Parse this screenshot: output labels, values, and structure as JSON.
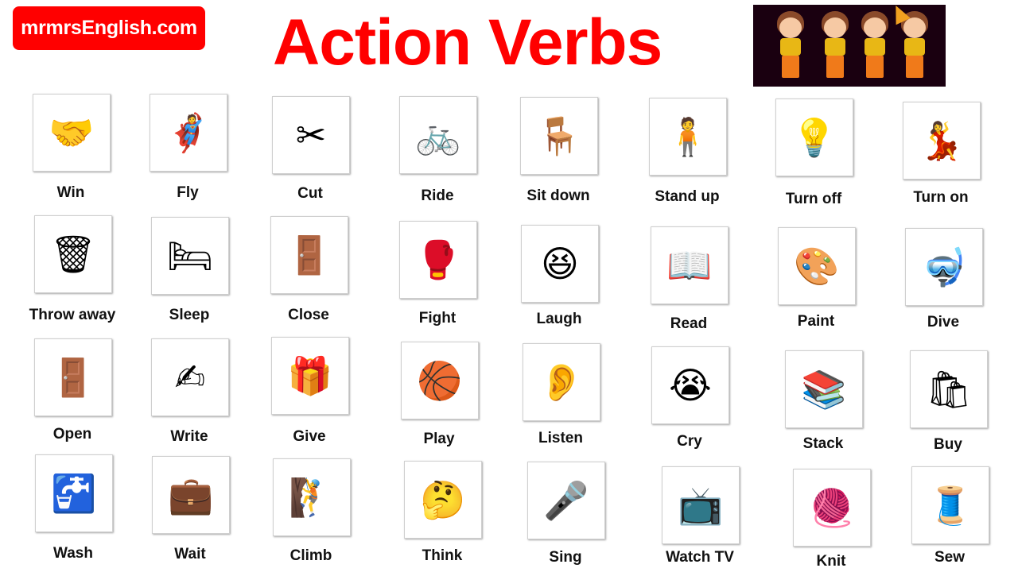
{
  "header": {
    "brand": "mrmrsEnglish.com",
    "title": "Action Verbs",
    "banner_image": "four-cartoon-kids-emotions",
    "brand_color": "#ff0000",
    "title_color": "#ff0000"
  },
  "verbs": [
    {
      "label": "Win",
      "icon": "handshake-icon",
      "glyph": "🤝"
    },
    {
      "label": "Fly",
      "icon": "superhero-flying-icon",
      "glyph": "🦸"
    },
    {
      "label": "Cut",
      "icon": "scissors-icon",
      "glyph": "✂"
    },
    {
      "label": "Ride",
      "icon": "bicycle-icon",
      "glyph": "🚲"
    },
    {
      "label": "Sit down",
      "icon": "chair-icon",
      "glyph": "🪑"
    },
    {
      "label": "Stand up",
      "icon": "standing-person-icon",
      "glyph": "🧍"
    },
    {
      "label": "Turn off",
      "icon": "lamp-icon",
      "glyph": "💡"
    },
    {
      "label": "Turn on",
      "icon": "dancing-girl-icon",
      "glyph": "💃"
    },
    {
      "label": "Throw away",
      "icon": "trash-can-icon",
      "glyph": "🗑"
    },
    {
      "label": "Sleep",
      "icon": "bed-icon",
      "glyph": "🛏"
    },
    {
      "label": "Close",
      "icon": "door-icon",
      "glyph": "🚪"
    },
    {
      "label": "Fight",
      "icon": "boxing-icon",
      "glyph": "🥊"
    },
    {
      "label": "Laugh",
      "icon": "laughing-face-icon",
      "glyph": "😆"
    },
    {
      "label": "Read",
      "icon": "book-icon",
      "glyph": "📖"
    },
    {
      "label": "Paint",
      "icon": "palette-icon",
      "glyph": "🎨"
    },
    {
      "label": "Dive",
      "icon": "diver-icon",
      "glyph": "🤿"
    },
    {
      "label": "Open",
      "icon": "open-door-icon",
      "glyph": "🚪"
    },
    {
      "label": "Write",
      "icon": "pencil-icon",
      "glyph": "✍"
    },
    {
      "label": "Give",
      "icon": "gift-icon",
      "glyph": "🎁"
    },
    {
      "label": "Play",
      "icon": "basketball-icon",
      "glyph": "🏀"
    },
    {
      "label": "Listen",
      "icon": "ear-icon",
      "glyph": "👂"
    },
    {
      "label": "Cry",
      "icon": "crying-face-icon",
      "glyph": "😭"
    },
    {
      "label": "Stack",
      "icon": "books-stack-icon",
      "glyph": "📚"
    },
    {
      "label": "Buy",
      "icon": "shopping-bag-icon",
      "glyph": "🛍"
    },
    {
      "label": "Wash",
      "icon": "faucet-icon",
      "glyph": "🚰"
    },
    {
      "label": "Wait",
      "icon": "briefcase-icon",
      "glyph": "💼"
    },
    {
      "label": "Climb",
      "icon": "climber-icon",
      "glyph": "🧗"
    },
    {
      "label": "Think",
      "icon": "thinking-face-icon",
      "glyph": "🤔"
    },
    {
      "label": "Sing",
      "icon": "microphone-icon",
      "glyph": "🎤"
    },
    {
      "label": "Watch TV",
      "icon": "television-icon",
      "glyph": "📺"
    },
    {
      "label": "Knit",
      "icon": "yarn-icon",
      "glyph": "🧶"
    },
    {
      "label": "Sew",
      "icon": "sewing-needle-icon",
      "glyph": "🧵"
    }
  ]
}
